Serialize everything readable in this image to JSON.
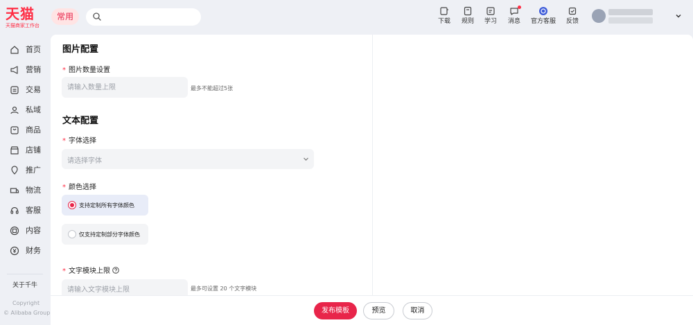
{
  "brand": {
    "name": "天猫",
    "subtitle": "天猫商家工作台"
  },
  "header": {
    "common_label": "常用",
    "search": {
      "placeholder": ""
    },
    "tools": [
      {
        "label": "下载",
        "icon": "download-icon",
        "badge": false
      },
      {
        "label": "规则",
        "icon": "rules-icon",
        "badge": false
      },
      {
        "label": "学习",
        "icon": "learn-icon",
        "badge": false
      },
      {
        "label": "消息",
        "icon": "message-icon",
        "badge": true
      },
      {
        "label": "官方客服",
        "icon": "official-service-icon",
        "badge": false
      },
      {
        "label": "反馈",
        "icon": "feedback-icon",
        "badge": false
      }
    ],
    "user": {
      "avatar_icon": "avatar-icon",
      "name_blurred": true
    }
  },
  "sidebar": {
    "items": [
      {
        "label": "首页",
        "icon": "home-icon"
      },
      {
        "label": "营销",
        "icon": "megaphone-icon"
      },
      {
        "label": "交易",
        "icon": "trade-icon"
      },
      {
        "label": "私域",
        "icon": "private-domain-icon"
      },
      {
        "label": "商品",
        "icon": "product-icon"
      },
      {
        "label": "店铺",
        "icon": "store-icon"
      },
      {
        "label": "推广",
        "icon": "promotion-icon"
      },
      {
        "label": "物流",
        "icon": "logistics-icon"
      },
      {
        "label": "客服",
        "icon": "service-icon"
      },
      {
        "label": "内容",
        "icon": "content-icon"
      },
      {
        "label": "财务",
        "icon": "finance-icon"
      }
    ],
    "about": "关于千牛",
    "copyright": "Copyright",
    "copyright_owner": "© Alibaba Group"
  },
  "form": {
    "image_section": {
      "title": "图片配置",
      "count_label": "图片数量设置",
      "count_placeholder": "请输入数量上限",
      "count_hint": "最多不能超过5张"
    },
    "text_section": {
      "title": "文本配置",
      "font_label": "字体选择",
      "font_placeholder": "请选择字体",
      "color_label": "颜色选择",
      "color_options": [
        {
          "label": "支持定制所有字体颜色",
          "selected": true
        },
        {
          "label": "仅支持定制部分字体颜色",
          "selected": false
        }
      ],
      "block_label": "文字模块上限",
      "block_placeholder": "请输入文字模块上限",
      "block_hint": "最多可设置 20 个文字模块"
    },
    "required_mark": "*"
  },
  "footer": {
    "publish_label": "发布模板",
    "preview_label": "预览",
    "cancel_label": "取消"
  },
  "colors": {
    "accent": "#e8254a",
    "brand": "#ff2d44",
    "background": "#eef0f5",
    "selected_option_bg": "#e8ecf8"
  }
}
